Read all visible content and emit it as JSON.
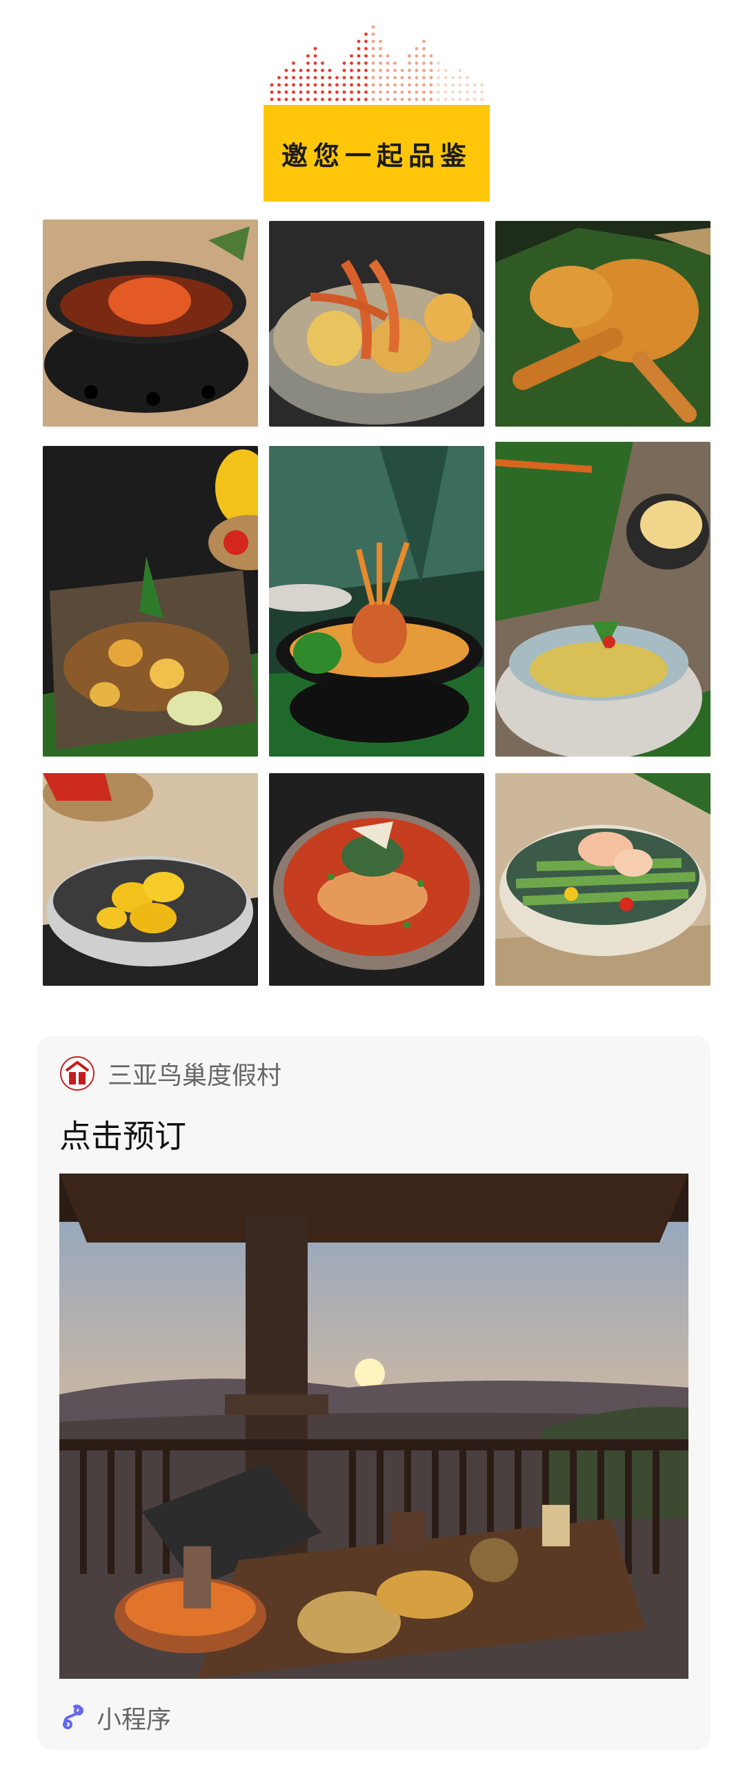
{
  "header": {
    "invite_text": "邀您一起品鉴",
    "accent_color": "#FFC60A",
    "dot_colors": [
      "#E63B2E",
      "#F0A48A",
      "#F6D9C8"
    ]
  },
  "dishes": [
    {
      "icon": "claypot-crab-dish"
    },
    {
      "icon": "grilled-prawns-dish"
    },
    {
      "icon": "roast-chicken-dish"
    },
    {
      "icon": "stir-fry-dish"
    },
    {
      "icon": "lobster-pot-dish"
    },
    {
      "icon": "stone-bowl-dish"
    },
    {
      "icon": "pineapple-bowl-dish"
    },
    {
      "icon": "chili-fish-soup-dish"
    },
    {
      "icon": "shrimp-asparagus-dish"
    }
  ],
  "card": {
    "brand_name": "三亚鸟巢度假村",
    "title": "点击预订",
    "hero_icon": "sunset-terrace-image",
    "mini_program_label": "小程序",
    "mini_program_color": "#6467F0"
  }
}
